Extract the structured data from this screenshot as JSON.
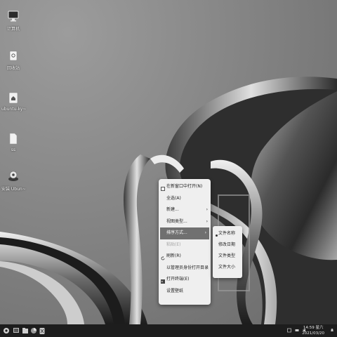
{
  "desktop_icons": [
    {
      "label": "计算机",
      "icon": "computer-icon"
    },
    {
      "label": "回收站",
      "icon": "trash-icon"
    },
    {
      "label": "ubuntu-ky~",
      "icon": "home-folder-icon"
    },
    {
      "label": "ss",
      "icon": "file-icon"
    },
    {
      "label": "安装 Ubun~",
      "icon": "installer-icon"
    }
  ],
  "context_menu": {
    "items": [
      {
        "label": "在新窗口中打开(N)",
        "icon": "open-window-icon"
      },
      {
        "label": "全选(A)"
      },
      {
        "label": "新建...",
        "submenu": true
      },
      {
        "label": "视图类型...",
        "submenu": true
      },
      {
        "label": "排序方式...",
        "submenu": true,
        "active": true
      },
      {
        "label": "粘贴(E)",
        "disabled": true
      },
      {
        "label": "刷新(R)",
        "icon": "refresh-icon"
      },
      {
        "label": "以管理员身份打开目录"
      },
      {
        "label": "打开终端(E)",
        "icon": "terminal-icon"
      },
      {
        "label": "设置壁纸"
      }
    ]
  },
  "sort_submenu": {
    "items": [
      "文件名称",
      "修改日期",
      "文件类型",
      "文件大小"
    ],
    "selected_index": 0
  },
  "taskbar": {
    "time": "14:59 星六",
    "date": "2021/03/20"
  },
  "colors": {
    "menu_bg": "#efefef",
    "menu_active": "#707070",
    "taskbar_bg": "#1d1d1d"
  }
}
